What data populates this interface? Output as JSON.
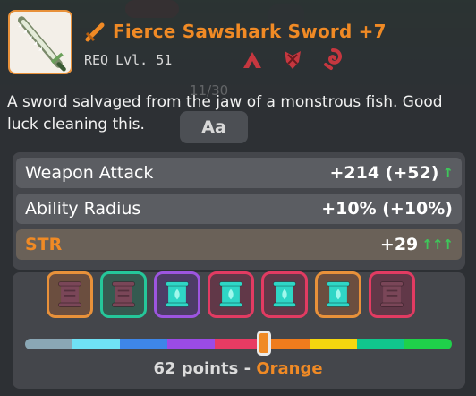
{
  "item": {
    "name": "Fierce Sawshark Sword +7",
    "req_label": "REQ",
    "req_level": "Lvl. 51",
    "icon": "sawshark-sword-icon",
    "title_icon": "sword-icon",
    "class_icons": [
      "warrior-icon",
      "guardian-icon",
      "swordmaster-icon"
    ]
  },
  "description": "A sword salvaged from the jaw of a monstrous fish. Good luck cleaning this.",
  "page_counter": "11/30",
  "font_button_label": "Aa",
  "stats": [
    {
      "name": "Weapon Attack",
      "value": "+214 (+52)",
      "arrows": "↑",
      "highlight": false
    },
    {
      "name": "Ability Radius",
      "value": "+10% (+10%)",
      "arrows": "",
      "highlight": false
    },
    {
      "name": "STR",
      "value": "+29",
      "arrows": "↑↑↑",
      "highlight": true
    }
  ],
  "scrolls": [
    {
      "border": "#e8913a",
      "bg": "#6b4e3f",
      "scroll": "#7a4658",
      "glow": false
    },
    {
      "border": "#25c79a",
      "bg": "#355a50",
      "scroll": "#7a4658",
      "glow": false
    },
    {
      "border": "#9d55e0",
      "bg": "#4d3c66",
      "scroll": "#2fd6c6",
      "glow": true
    },
    {
      "border": "#e23b62",
      "bg": "#613848",
      "scroll": "#2fd6c6",
      "glow": true
    },
    {
      "border": "#e23b62",
      "bg": "#613848",
      "scroll": "#2fd6c6",
      "glow": true
    },
    {
      "border": "#e8913a",
      "bg": "#6b4e3f",
      "scroll": "#2fd6c6",
      "glow": true
    },
    {
      "border": "#e23b62",
      "bg": "#613848",
      "scroll": "#7a4658",
      "glow": false
    }
  ],
  "tier_colors": [
    "#8aa7b5",
    "#6fe1f5",
    "#3e86e8",
    "#9b4be6",
    "#e83b63",
    "#f07c1d",
    "#f5d70f",
    "#10c68d",
    "#1fd14a"
  ],
  "tier_position": 0.56,
  "points_text": "62 points -",
  "tier_name": "Orange",
  "colors": {
    "accent": "#f08a25",
    "up": "#3ec75a"
  }
}
